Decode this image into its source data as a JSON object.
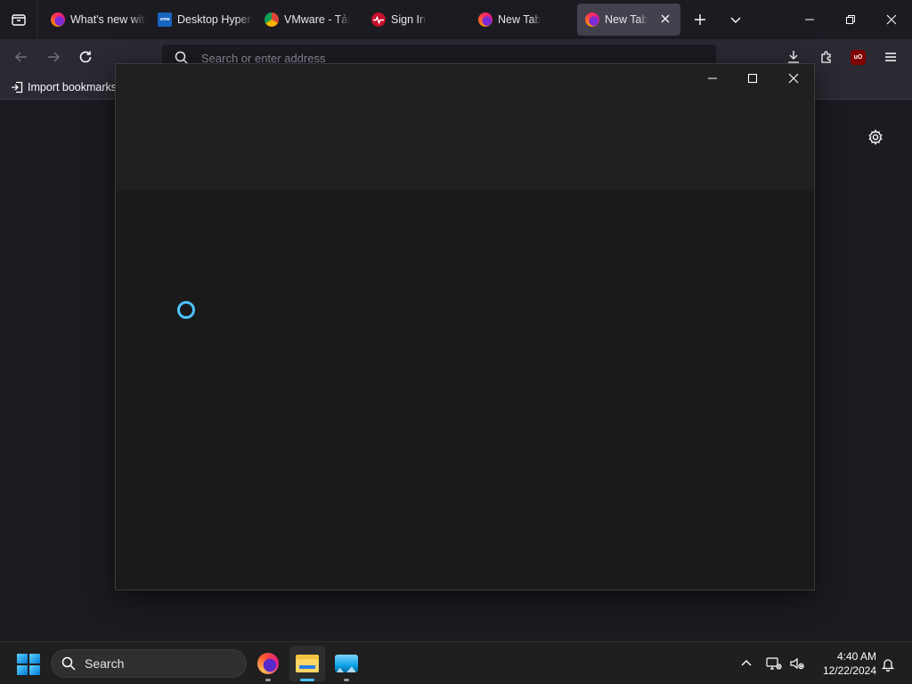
{
  "browser": {
    "tabs": [
      {
        "label": "What's new with Firefox",
        "favicon": "firefox-icon",
        "active": false
      },
      {
        "label": "Desktop Hypervisor",
        "favicon": "vmware-icon",
        "active": false
      },
      {
        "label": "VMware - Tải",
        "favicon": "chrome-icon",
        "active": false
      },
      {
        "label": "Sign In",
        "favicon": "pulse-icon",
        "active": false
      },
      {
        "label": "New Tab",
        "favicon": "firefox-icon",
        "active": false
      },
      {
        "label": "New Tab",
        "favicon": "firefox-icon",
        "active": true
      }
    ],
    "address_placeholder": "Search or enter address",
    "bookmarks": {
      "import_label": "Import bookmarks..."
    },
    "extension_badge": "uO",
    "vmware_favicon_text": "vmw"
  },
  "taskbar": {
    "search_label": "Search",
    "clock_time": "4:40 AM",
    "clock_date": "12/22/2024",
    "apps": [
      {
        "name": "Firefox",
        "active": false
      },
      {
        "name": "File Explorer",
        "active": true
      },
      {
        "name": "Photos",
        "active": false
      }
    ]
  },
  "colors": {
    "accent": "#4cc2ff",
    "browser_bg": "#1c1b22",
    "dialog_bg": "#1a1a1a",
    "taskbar_bg": "#1f1f1f"
  }
}
